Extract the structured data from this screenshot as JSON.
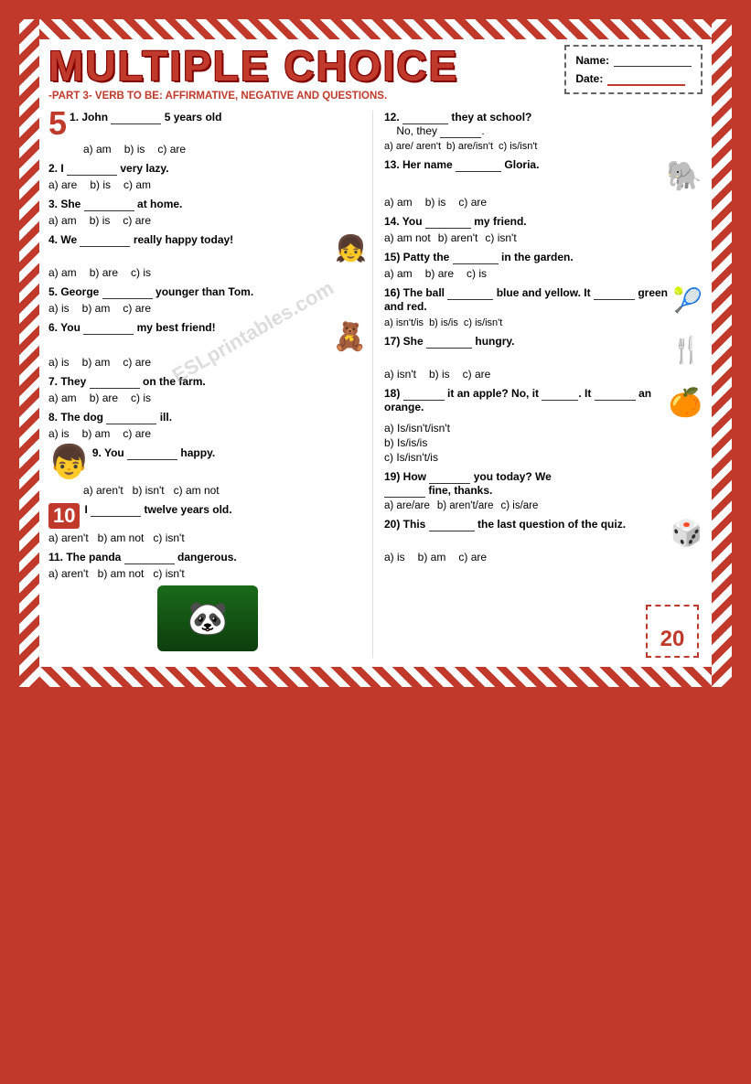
{
  "header": {
    "title": "MULTIPLE CHOICE",
    "subtitle": "-PART 3- VERB TO BE: AFFIRMATIVE, NEGATIVE AND QUESTIONS.",
    "name_label": "Name:",
    "date_label": "Date:"
  },
  "left_questions": [
    {
      "number": "1",
      "icon": "5",
      "text": "John",
      "blank_count": 1,
      "after_blank": "5 years old",
      "options": [
        {
          "label": "a) am"
        },
        {
          "label": "b) is"
        },
        {
          "label": "c) are"
        }
      ]
    },
    {
      "number": "2",
      "text": "I",
      "blank_count": 1,
      "after_blank": "very lazy.",
      "options": [
        {
          "label": "a) are"
        },
        {
          "label": "b) is"
        },
        {
          "label": "c) am"
        }
      ]
    },
    {
      "number": "3",
      "text": "She",
      "blank_count": 1,
      "after_blank": "at home.",
      "options": [
        {
          "label": "a) am"
        },
        {
          "label": "b) is"
        },
        {
          "label": "c) are"
        }
      ]
    },
    {
      "number": "4",
      "text": "We",
      "blank_count": 1,
      "after_blank": "really happy today!",
      "options": [
        {
          "label": "a) am"
        },
        {
          "label": "b) are"
        },
        {
          "label": "c) is"
        }
      ],
      "deco": "👧"
    },
    {
      "number": "5",
      "text": "George",
      "blank_count": 1,
      "after_blank": "younger than Tom.",
      "options": [
        {
          "label": "a) is"
        },
        {
          "label": "b) am"
        },
        {
          "label": "c) are"
        }
      ]
    },
    {
      "number": "6",
      "text": "You",
      "blank_count": 1,
      "after_blank": "my best friend!",
      "options": [
        {
          "label": "a) is"
        },
        {
          "label": "b) am"
        },
        {
          "label": "c) are"
        }
      ],
      "deco": "🐻"
    },
    {
      "number": "7",
      "text": "They",
      "blank_count": 1,
      "after_blank": "on the farm.",
      "options": [
        {
          "label": "a) am"
        },
        {
          "label": "b) are"
        },
        {
          "label": "c) is"
        }
      ]
    },
    {
      "number": "8",
      "text": "The dog",
      "blank_count": 1,
      "after_blank": "ill.",
      "options": [
        {
          "label": "a) is"
        },
        {
          "label": "b) am"
        },
        {
          "label": "c) are"
        }
      ]
    },
    {
      "number": "9",
      "text": "You",
      "blank_count": 1,
      "after_blank": "happy.",
      "options": [
        {
          "label": "a) aren't"
        },
        {
          "label": "b) isn't"
        },
        {
          "label": "c) am not"
        }
      ],
      "deco": "👦"
    },
    {
      "number": "10",
      "icon": "10",
      "text": "I",
      "blank_count": 1,
      "after_blank": "twelve years old.",
      "options": [
        {
          "label": "a) aren't"
        },
        {
          "label": "b) am not"
        },
        {
          "label": "c) isn't"
        }
      ]
    },
    {
      "number": "11",
      "text": "The panda",
      "blank_count": 1,
      "after_blank": "dangerous.",
      "options": [
        {
          "label": "a) aren't"
        },
        {
          "label": "b) am not"
        },
        {
          "label": "c) isn't"
        }
      ],
      "has_panda": true
    }
  ],
  "right_questions": [
    {
      "number": "12",
      "text": "",
      "intro": "_________ they at school? No, they _________.",
      "options": [
        {
          "label": "a) are/ aren't"
        },
        {
          "label": "b) are/isn't"
        },
        {
          "label": "c) is/isn't"
        }
      ]
    },
    {
      "number": "13",
      "text": "Her name",
      "blank_count": 1,
      "after_blank": "Gloria.",
      "options": [
        {
          "label": "a) am"
        },
        {
          "label": "b) is"
        },
        {
          "label": "c) are"
        }
      ],
      "deco": "🐘"
    },
    {
      "number": "14",
      "text": "You",
      "blank_count": 1,
      "after_blank": "my friend.",
      "options": [
        {
          "label": "a) am not"
        },
        {
          "label": "b) aren't"
        },
        {
          "label": "c) isn't"
        }
      ]
    },
    {
      "number": "15",
      "intro": "Patty the",
      "text": "",
      "blank_count": 1,
      "after_blank": "in the garden.",
      "options": [
        {
          "label": "a) am"
        },
        {
          "label": "b) are"
        },
        {
          "label": "c) is"
        }
      ]
    },
    {
      "number": "16",
      "text": "The ball",
      "blank_count": 1,
      "after_blank": "blue and yellow. It",
      "blank2": true,
      "after_blank2": "green and red.",
      "options": [
        {
          "label": "a) isn't/is"
        },
        {
          "label": "b) is/is"
        },
        {
          "label": "c) is/isn't"
        }
      ],
      "deco": "🏐"
    },
    {
      "number": "17",
      "text": "She",
      "blank_count": 1,
      "after_blank": "hungry.",
      "options": [
        {
          "label": "a) isn't"
        },
        {
          "label": "b) is"
        },
        {
          "label": "c) are"
        }
      ],
      "deco": "🍽️"
    },
    {
      "number": "18",
      "intro": "_________ it an apple? No, it _________. It _________ an orange.",
      "text": "",
      "options_multi": [
        {
          "label": "a) Is/isn't/isn't"
        },
        {
          "label": "b) Is/is/is"
        },
        {
          "label": "c) Is/isn't/is"
        }
      ],
      "deco": "🍊"
    },
    {
      "number": "19",
      "intro": "How _________ you today? We _________ fine, thanks.",
      "text": "",
      "options": [
        {
          "label": "a) are/are"
        },
        {
          "label": "b) aren't/are"
        },
        {
          "label": "c) is/are"
        }
      ]
    },
    {
      "number": "20",
      "text": "This",
      "blank_count": 1,
      "after_blank": "the last question of the quiz.",
      "options": [
        {
          "label": "a) is"
        },
        {
          "label": "b) am"
        },
        {
          "label": "c) are"
        }
      ],
      "deco": "🎲"
    }
  ],
  "score": {
    "value": "20"
  },
  "watermark": "ESLprintables.com"
}
